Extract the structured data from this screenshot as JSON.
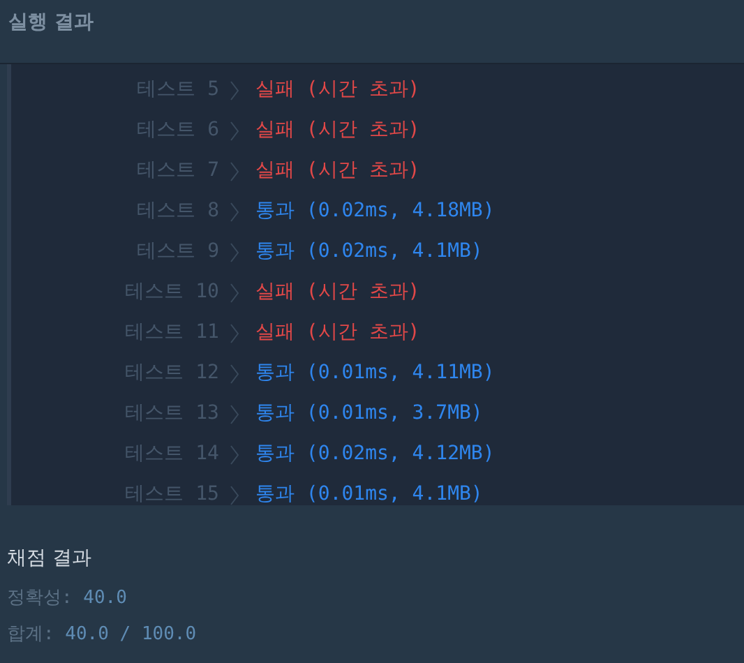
{
  "header": {
    "title": "실행 결과"
  },
  "tests": [
    {
      "label": "테스트 5",
      "kind": "fail",
      "result": "실패 (시간 초과)"
    },
    {
      "label": "테스트 6",
      "kind": "fail",
      "result": "실패 (시간 초과)"
    },
    {
      "label": "테스트 7",
      "kind": "fail",
      "result": "실패 (시간 초과)"
    },
    {
      "label": "테스트 8",
      "kind": "pass",
      "result": "통과 (0.02ms, 4.18MB)"
    },
    {
      "label": "테스트 9",
      "kind": "pass",
      "result": "통과 (0.02ms, 4.1MB)"
    },
    {
      "label": "테스트 10",
      "kind": "fail",
      "result": "실패 (시간 초과)"
    },
    {
      "label": "테스트 11",
      "kind": "fail",
      "result": "실패 (시간 초과)"
    },
    {
      "label": "테스트 12",
      "kind": "pass",
      "result": "통과 (0.01ms, 4.11MB)"
    },
    {
      "label": "테스트 13",
      "kind": "pass",
      "result": "통과 (0.01ms, 3.7MB)"
    },
    {
      "label": "테스트 14",
      "kind": "pass",
      "result": "통과 (0.02ms, 4.12MB)"
    },
    {
      "label": "테스트 15",
      "kind": "pass",
      "result": "통과 (0.01ms, 4.1MB)"
    }
  ],
  "grading": {
    "title": "채점 결과",
    "lines": [
      {
        "label": "정확성:",
        "value": "40.0"
      },
      {
        "label": "합계:",
        "value": "40.0 / 100.0"
      }
    ]
  }
}
